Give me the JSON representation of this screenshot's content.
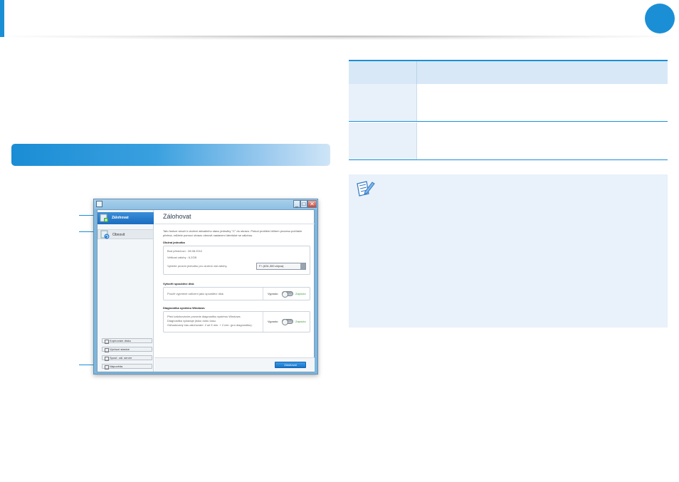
{
  "window": {
    "title_bar": {
      "minimize": "_",
      "maximize": "□",
      "close": "✕"
    },
    "sidebar": {
      "items": [
        {
          "label": "Zálohovat"
        },
        {
          "label": "Obnovit"
        }
      ],
      "buttons": [
        {
          "label": "Kopírování disku"
        },
        {
          "label": "Výchozí stanice"
        },
        {
          "label": "Spusť. zál. server"
        },
        {
          "label": "Nápověda"
        }
      ]
    },
    "main": {
      "title": "Zálohovat",
      "description": "Tato funkce slouží k uložení aktuálního stavu jednotky \"C\" do obrazu. Pokud problém během procesu počítače přetrvá, můžete pomocí obrazu obnovit nastavení identické se zálohou.",
      "storage": {
        "label": "Úložná jednotka",
        "last_backup": "Bod předchozí : 08.08.2012",
        "backup_size": "Velikost zálohy : 6,2GB",
        "select_prompt": "Vyberte prosím jednotku pro uložení dat zálohy.",
        "selected_drive": "F:\\ (631,300 zbýva)"
      },
      "rescue_disk": {
        "label": "Vytvořit spouštěcí disk",
        "text": "Použít vyjímené zařízení jako spouštěcí disk.",
        "off_label": "Vypnuto",
        "on_label": "Zapnuto"
      },
      "diagnostics": {
        "label": "Diagnostika systému Windows",
        "line1": "Před zálohováním provede diagnostiku systému Windows.",
        "line2": "Diagnostika vyžaduje jistou dobu času.",
        "line3": "Odhadovaný čas zálohování: 2 až 5 min. + 2 min. (pro diagnostiku).",
        "off_label": "Vypnuto",
        "on_label": "Zapnuto"
      },
      "primary_button": "Zálohovat"
    }
  },
  "colors": {
    "accent": "#1b8fd6",
    "table_header": "#d8e8f7",
    "note_bg": "#e9f1fa"
  },
  "icons": {
    "note": "pencil-note-icon",
    "backup": "backup-icon",
    "restore": "restore-icon"
  }
}
